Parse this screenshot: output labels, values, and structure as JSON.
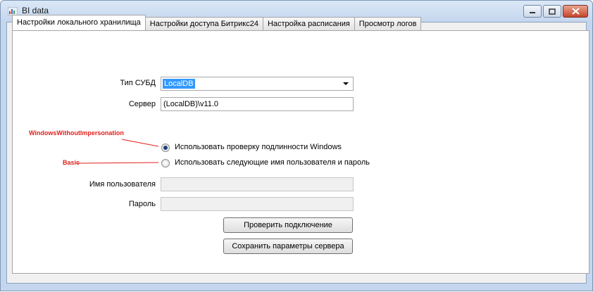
{
  "window": {
    "title": "BI data"
  },
  "tabs": [
    {
      "label": "Настройки локального хранилища",
      "active": true
    },
    {
      "label": "Настройки доступа Битрикс24",
      "active": false
    },
    {
      "label": "Настройка расписания",
      "active": false
    },
    {
      "label": "Просмотр логов",
      "active": false
    }
  ],
  "form": {
    "db_type_label": "Тип СУБД",
    "db_type_value": "LocalDB",
    "server_label": "Сервер",
    "server_value": "(LocalDB)\\v11.0",
    "radio_windows_label": "Использовать проверку подлинности Windows",
    "radio_user_label": "Использовать следующие имя пользователя и пароль",
    "username_label": "Имя пользователя",
    "username_value": "",
    "password_label": "Пароль",
    "password_value": "",
    "check_button": "Проверить подключение",
    "save_button": "Сохранить параметры сервера"
  },
  "annotations": {
    "windows_note": "WindowsWithoutImpersonation",
    "basic_note": "Basic",
    "color": "#e0201b"
  }
}
